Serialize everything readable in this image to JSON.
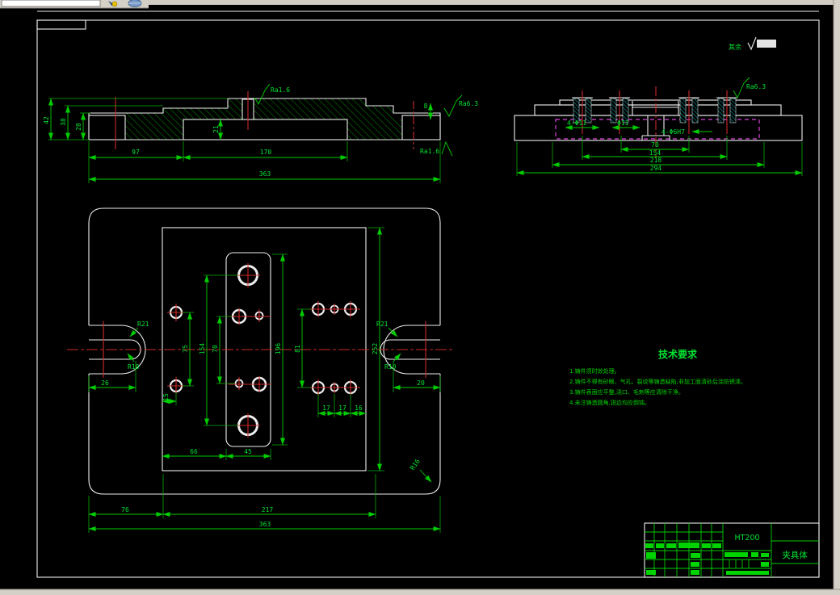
{
  "toolbar": {
    "address_value": "",
    "icons": [
      {
        "name": "pencil-spark-icon"
      },
      {
        "name": "globe-icon"
      }
    ]
  },
  "general_note": {
    "label": "其余",
    "symbol": "√"
  },
  "front_view": {
    "dims": {
      "h42": "42",
      "h38": "38",
      "h28": "28",
      "h21": "21",
      "h8": "8",
      "w97": "97",
      "w170": "170",
      "w363": "363"
    },
    "finish": {
      "top": "Ra1.6",
      "right": "Ra6.3",
      "bottom": "Ra1.6"
    }
  },
  "side_view": {
    "dims": {
      "w70": "70",
      "w154": "154",
      "w218": "218",
      "w294": "294"
    },
    "hole_notes": {
      "left": "4-Φ11",
      "center": "Φ11",
      "right": "4-Φ6H7"
    },
    "finish": {
      "top": "Ra6.3"
    }
  },
  "plan_view": {
    "radii": {
      "slot_outer_left": "R21",
      "slot_inner_left": "R10",
      "slot_outer_right": "R21",
      "slot_inner_right": "R10",
      "corner": "R16"
    },
    "dims": {
      "slot_left": "26",
      "slot_right": "20",
      "col75": "75",
      "col154": "154",
      "col70": "70",
      "col196": "196",
      "col81": "81",
      "col252": "252",
      "off15": "15",
      "w66": "66",
      "w45": "45",
      "p17a": "17",
      "p17b": "17",
      "p16": "16",
      "w76": "76",
      "w217": "217",
      "w363": "363"
    }
  },
  "tech_requirements": {
    "title": "技术要求",
    "lines": [
      "1.铸件须时效处理。",
      "2.铸件不得有砂眼、气孔、裂纹等铸造缺陷,非加工面清砂后涂防锈漆。",
      "3.铸件表面应平整,浇口、毛刺等应清除干净。",
      "4.未注铸造圆角,锐边均应倒钝。"
    ]
  },
  "title_block": {
    "material": "HT200",
    "part_name": "夹具体"
  },
  "colors": {
    "line_green": "#00cc00",
    "centerline_red": "#cc2a2a",
    "hidden_magenta": "#dd44dd",
    "bushing_cyan": "#00cccc",
    "outline_white": "#eeeeee",
    "background": "#000000",
    "chrome_gray": "#d4d0c8"
  }
}
